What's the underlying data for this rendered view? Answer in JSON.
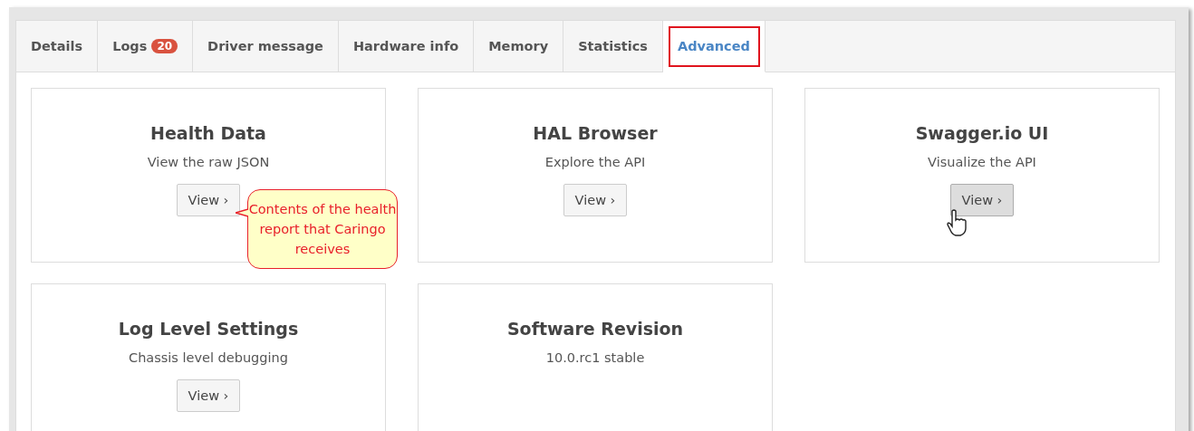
{
  "tabs": [
    {
      "label": "Details",
      "selected": false
    },
    {
      "label": "Logs",
      "badge": "20",
      "selected": false
    },
    {
      "label": "Driver message",
      "selected": false
    },
    {
      "label": "Hardware info",
      "selected": false
    },
    {
      "label": "Memory",
      "selected": false
    },
    {
      "label": "Statistics",
      "selected": false
    },
    {
      "label": "Advanced",
      "selected": true
    }
  ],
  "cards": [
    {
      "title": "Health Data",
      "subtitle": "View the raw JSON",
      "button": {
        "label": "View ›",
        "hovered": false
      },
      "callout": "Contents of the health report that Caringo receives"
    },
    {
      "title": "HAL Browser",
      "subtitle": "Explore the API",
      "button": {
        "label": "View ›",
        "hovered": false
      }
    },
    {
      "title": "Swagger.io UI",
      "subtitle": "Visualize the API",
      "button": {
        "label": "View ›",
        "hovered": true
      }
    },
    {
      "title": "Log Level Settings",
      "subtitle": "Chassis level debugging",
      "button": {
        "label": "View ›",
        "hovered": false
      }
    },
    {
      "title": "Software Revision",
      "subtitle": "10.0.rc1 stable"
    }
  ]
}
